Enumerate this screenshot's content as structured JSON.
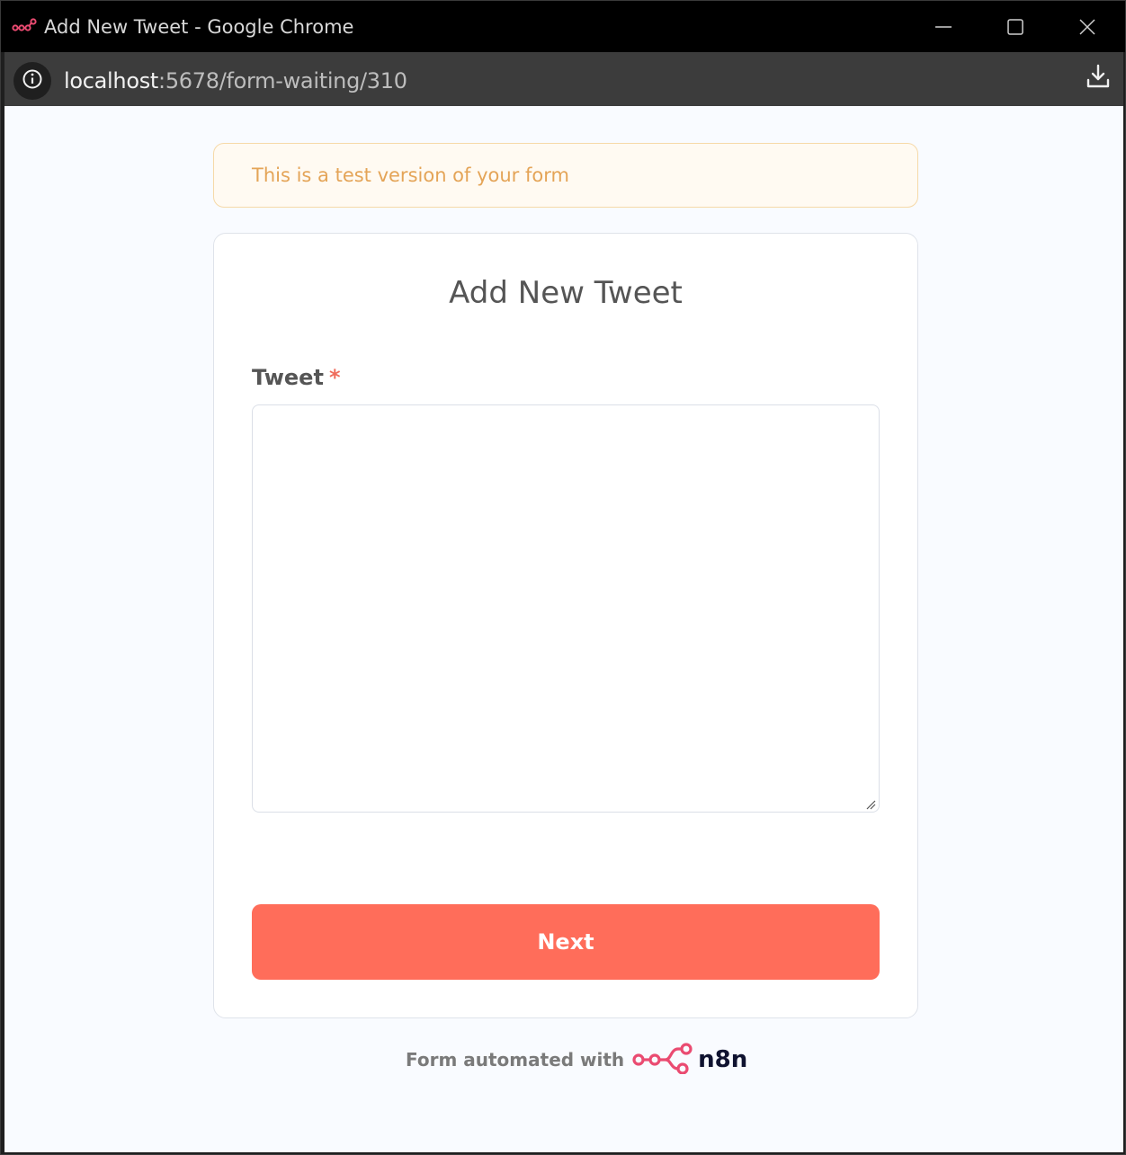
{
  "window": {
    "title": "Add New Tweet - Google Chrome",
    "controls": [
      "minimize-icon",
      "maximize-icon",
      "close-icon"
    ]
  },
  "address_bar": {
    "url_host": "localhost",
    "url_path": ":5678/form-waiting/310",
    "icons": [
      "site-info-icon",
      "download-icon"
    ]
  },
  "page": {
    "test_banner": "This is a test version of your form",
    "form": {
      "title": "Add New Tweet",
      "field_label": "Tweet",
      "required_marker": "*",
      "field_value": "",
      "submit_label": "Next"
    },
    "footer": {
      "text": "Form automated with",
      "brand": "n8n"
    }
  },
  "colors": {
    "accent": "#ff6d5a",
    "banner_text": "#e4a457",
    "brand_logo": "#ea4b71",
    "brand_text": "#101330"
  }
}
